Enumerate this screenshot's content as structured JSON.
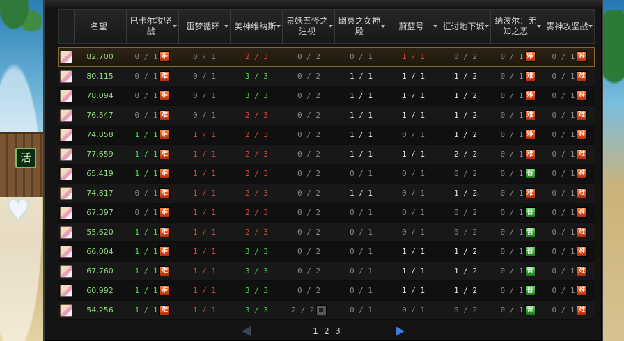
{
  "headers": [
    {
      "label": "",
      "width": 22
    },
    {
      "label": "名望",
      "width": 75
    },
    {
      "label": "巴卡尔攻坚战",
      "width": 75
    },
    {
      "label": "噩梦循环",
      "width": 75
    },
    {
      "label": "美神维纳斯",
      "width": 75
    },
    {
      "label": "祟妖五怪之注视",
      "width": 75
    },
    {
      "label": "幽冥之女神殿",
      "width": 75
    },
    {
      "label": "蔚蓝号",
      "width": 75
    },
    {
      "label": "征讨地下城",
      "width": 75
    },
    {
      "label": "纳波尔：无知之恶",
      "width": 75
    },
    {
      "label": "雾神攻坚战",
      "width": 73
    }
  ],
  "badges": {
    "hard": "难",
    "normal": "普",
    "lock": "■"
  },
  "rows": [
    {
      "fame": "82,700",
      "c": [
        [
          "0 / 1",
          "gray",
          "hard"
        ],
        [
          "0 / 1",
          "gray",
          ""
        ],
        [
          "2 / 3",
          "red",
          ""
        ],
        [
          "0 / 2",
          "gray",
          ""
        ],
        [
          "0 / 1",
          "gray",
          ""
        ],
        [
          "1 / 1",
          "red",
          ""
        ],
        [
          "0 / 2",
          "gray",
          ""
        ],
        [
          "0 / 1",
          "gray",
          "hard"
        ],
        [
          "0 / 1",
          "gray",
          "hard"
        ]
      ]
    },
    {
      "fame": "80,115",
      "c": [
        [
          "0 / 1",
          "gray",
          "hard"
        ],
        [
          "0 / 1",
          "gray",
          ""
        ],
        [
          "3 / 3",
          "green",
          ""
        ],
        [
          "0 / 2",
          "gray",
          ""
        ],
        [
          "1 / 1",
          "white",
          ""
        ],
        [
          "1 / 1",
          "white",
          ""
        ],
        [
          "1 / 2",
          "white",
          ""
        ],
        [
          "0 / 1",
          "gray",
          "hard"
        ],
        [
          "0 / 1",
          "gray",
          "hard"
        ]
      ]
    },
    {
      "fame": "78,094",
      "c": [
        [
          "0 / 1",
          "gray",
          "hard"
        ],
        [
          "0 / 1",
          "gray",
          ""
        ],
        [
          "3 / 3",
          "green",
          ""
        ],
        [
          "0 / 2",
          "gray",
          ""
        ],
        [
          "1 / 1",
          "white",
          ""
        ],
        [
          "1 / 1",
          "white",
          ""
        ],
        [
          "1 / 2",
          "white",
          ""
        ],
        [
          "0 / 1",
          "gray",
          "hard"
        ],
        [
          "0 / 1",
          "gray",
          "hard"
        ]
      ]
    },
    {
      "fame": "76,547",
      "c": [
        [
          "0 / 1",
          "gray",
          "hard"
        ],
        [
          "0 / 1",
          "gray",
          ""
        ],
        [
          "2 / 3",
          "red",
          ""
        ],
        [
          "0 / 2",
          "gray",
          ""
        ],
        [
          "1 / 1",
          "white",
          ""
        ],
        [
          "1 / 1",
          "white",
          ""
        ],
        [
          "1 / 2",
          "white",
          ""
        ],
        [
          "0 / 1",
          "gray",
          "hard"
        ],
        [
          "0 / 1",
          "gray",
          "hard"
        ]
      ]
    },
    {
      "fame": "74,858",
      "c": [
        [
          "1 / 1",
          "green",
          "hard"
        ],
        [
          "1 / 1",
          "red",
          ""
        ],
        [
          "2 / 3",
          "red",
          ""
        ],
        [
          "0 / 2",
          "gray",
          ""
        ],
        [
          "1 / 1",
          "white",
          ""
        ],
        [
          "0 / 1",
          "gray",
          ""
        ],
        [
          "1 / 2",
          "white",
          ""
        ],
        [
          "0 / 1",
          "gray",
          "hard"
        ],
        [
          "0 / 1",
          "gray",
          "hard"
        ]
      ]
    },
    {
      "fame": "77,659",
      "c": [
        [
          "1 / 1",
          "green",
          "hard"
        ],
        [
          "1 / 1",
          "red",
          ""
        ],
        [
          "2 / 3",
          "red",
          ""
        ],
        [
          "0 / 2",
          "gray",
          ""
        ],
        [
          "1 / 1",
          "white",
          ""
        ],
        [
          "1 / 1",
          "white",
          ""
        ],
        [
          "2 / 2",
          "white",
          ""
        ],
        [
          "0 / 1",
          "gray",
          "hard"
        ],
        [
          "0 / 1",
          "gray",
          "hard"
        ]
      ]
    },
    {
      "fame": "65,419",
      "c": [
        [
          "1 / 1",
          "green",
          "hard"
        ],
        [
          "1 / 1",
          "red",
          ""
        ],
        [
          "2 / 3",
          "red",
          ""
        ],
        [
          "0 / 2",
          "gray",
          ""
        ],
        [
          "0 / 1",
          "gray",
          ""
        ],
        [
          "0 / 1",
          "gray",
          ""
        ],
        [
          "0 / 2",
          "gray",
          ""
        ],
        [
          "0 / 1",
          "gray",
          "normal"
        ],
        [
          "0 / 1",
          "gray",
          "hard"
        ]
      ]
    },
    {
      "fame": "74,817",
      "c": [
        [
          "0 / 1",
          "gray",
          "hard"
        ],
        [
          "1 / 1",
          "red",
          ""
        ],
        [
          "2 / 3",
          "red",
          ""
        ],
        [
          "0 / 2",
          "gray",
          ""
        ],
        [
          "1 / 1",
          "white",
          ""
        ],
        [
          "0 / 1",
          "gray",
          ""
        ],
        [
          "1 / 2",
          "white",
          ""
        ],
        [
          "0 / 1",
          "gray",
          "hard"
        ],
        [
          "0 / 1",
          "gray",
          "hard"
        ]
      ]
    },
    {
      "fame": "67,397",
      "c": [
        [
          "0 / 1",
          "gray",
          "hard"
        ],
        [
          "1 / 1",
          "red",
          ""
        ],
        [
          "2 / 3",
          "red",
          ""
        ],
        [
          "0 / 2",
          "gray",
          ""
        ],
        [
          "0 / 1",
          "gray",
          ""
        ],
        [
          "0 / 1",
          "gray",
          ""
        ],
        [
          "0 / 2",
          "gray",
          ""
        ],
        [
          "0 / 1",
          "gray",
          "normal"
        ],
        [
          "0 / 1",
          "gray",
          "hard"
        ]
      ]
    },
    {
      "fame": "55,620",
      "c": [
        [
          "1 / 1",
          "green",
          "hard"
        ],
        [
          "1 / 1",
          "red",
          ""
        ],
        [
          "2 / 3",
          "red",
          ""
        ],
        [
          "0 / 2",
          "gray",
          ""
        ],
        [
          "0 / 1",
          "gray",
          ""
        ],
        [
          "0 / 1",
          "gray",
          ""
        ],
        [
          "0 / 2",
          "gray",
          ""
        ],
        [
          "0 / 1",
          "gray",
          "normal"
        ],
        [
          "0 / 1",
          "gray",
          "hard"
        ]
      ]
    },
    {
      "fame": "66,004",
      "c": [
        [
          "1 / 1",
          "green",
          "hard"
        ],
        [
          "1 / 1",
          "red",
          ""
        ],
        [
          "3 / 3",
          "green",
          ""
        ],
        [
          "0 / 2",
          "gray",
          ""
        ],
        [
          "0 / 1",
          "gray",
          ""
        ],
        [
          "1 / 1",
          "white",
          ""
        ],
        [
          "1 / 2",
          "white",
          ""
        ],
        [
          "0 / 1",
          "gray",
          "normal"
        ],
        [
          "0 / 1",
          "gray",
          "hard"
        ]
      ]
    },
    {
      "fame": "67,760",
      "c": [
        [
          "1 / 1",
          "green",
          "hard"
        ],
        [
          "1 / 1",
          "red",
          ""
        ],
        [
          "3 / 3",
          "green",
          ""
        ],
        [
          "0 / 2",
          "gray",
          ""
        ],
        [
          "0 / 1",
          "gray",
          ""
        ],
        [
          "1 / 1",
          "white",
          ""
        ],
        [
          "1 / 2",
          "white",
          ""
        ],
        [
          "0 / 1",
          "gray",
          "normal"
        ],
        [
          "0 / 1",
          "gray",
          "hard"
        ]
      ]
    },
    {
      "fame": "60,992",
      "c": [
        [
          "1 / 1",
          "green",
          "hard"
        ],
        [
          "1 / 1",
          "red",
          ""
        ],
        [
          "3 / 3",
          "green",
          ""
        ],
        [
          "0 / 2",
          "gray",
          ""
        ],
        [
          "0 / 1",
          "gray",
          ""
        ],
        [
          "1 / 1",
          "white",
          ""
        ],
        [
          "1 / 2",
          "white",
          ""
        ],
        [
          "0 / 1",
          "gray",
          "normal"
        ],
        [
          "0 / 1",
          "gray",
          "hard"
        ]
      ]
    },
    {
      "fame": "54,256",
      "c": [
        [
          "1 / 1",
          "green",
          "hard"
        ],
        [
          "1 / 1",
          "red",
          ""
        ],
        [
          "3 / 3",
          "green",
          ""
        ],
        [
          "2 / 2",
          "gray",
          "lock"
        ],
        [
          "0 / 1",
          "gray",
          ""
        ],
        [
          "0 / 1",
          "gray",
          ""
        ],
        [
          "0 / 2",
          "gray",
          ""
        ],
        [
          "0 / 1",
          "gray",
          "normal"
        ],
        [
          "0 / 1",
          "gray",
          "hard"
        ]
      ]
    }
  ],
  "pager": {
    "pages": [
      "1",
      "2",
      "3"
    ],
    "current": "1"
  },
  "activity_label": "活",
  "colors": {
    "green": "#48e048",
    "red": "#e84a3a",
    "gray": "#8a8a8a",
    "accent": "#8a6a2a"
  }
}
